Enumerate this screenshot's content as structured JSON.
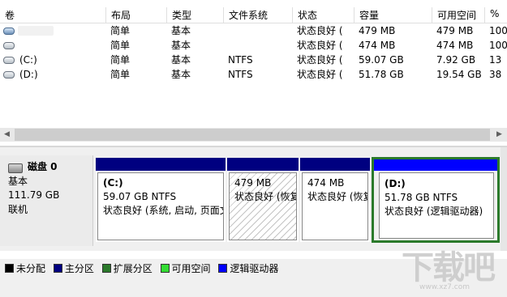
{
  "columns": [
    "卷",
    "布局",
    "类型",
    "文件系统",
    "状态",
    "容量",
    "可用空间",
    "%"
  ],
  "volumes": [
    {
      "name": "",
      "layout": "简单",
      "type": "基本",
      "fs": "",
      "status": "状态良好 (",
      "capacity": "479 MB",
      "free": "479 MB",
      "pct": "100"
    },
    {
      "name": "",
      "layout": "简单",
      "type": "基本",
      "fs": "",
      "status": "状态良好 (",
      "capacity": "474 MB",
      "free": "474 MB",
      "pct": "100"
    },
    {
      "name": "(C:)",
      "layout": "简单",
      "type": "基本",
      "fs": "NTFS",
      "status": "状态良好 (",
      "capacity": "59.07 GB",
      "free": "7.92 GB",
      "pct": "13"
    },
    {
      "name": "(D:)",
      "layout": "简单",
      "type": "基本",
      "fs": "NTFS",
      "status": "状态良好 (",
      "capacity": "51.78 GB",
      "free": "19.54 GB",
      "pct": "38"
    }
  ],
  "disk": {
    "name": "磁盘 0",
    "type": "基本",
    "size": "111.79 GB",
    "state": "联机"
  },
  "partitions": [
    {
      "title": "(C:)",
      "line1": "59.07 GB NTFS",
      "line2": "状态良好 (系统, 启动, 页面文"
    },
    {
      "title": "",
      "line1": "479 MB",
      "line2": "状态良好 (恢复"
    },
    {
      "title": "",
      "line1": "474 MB",
      "line2": "状态良好 (恢复"
    },
    {
      "title": "(D:)",
      "line1": "51.78 GB NTFS",
      "line2": "状态良好 (逻辑驱动器)"
    }
  ],
  "legend": [
    {
      "label": "未分配",
      "color": "#000000"
    },
    {
      "label": "主分区",
      "color": "#000080"
    },
    {
      "label": "扩展分区",
      "color": "#2b7a2b"
    },
    {
      "label": "可用空间",
      "color": "#33dd33"
    },
    {
      "label": "逻辑驱动器",
      "color": "#0000ff"
    }
  ],
  "icons": {
    "drive": "drive-icon",
    "disk": "disk-icon"
  },
  "watermark": {
    "site": "www.xz7.com"
  }
}
